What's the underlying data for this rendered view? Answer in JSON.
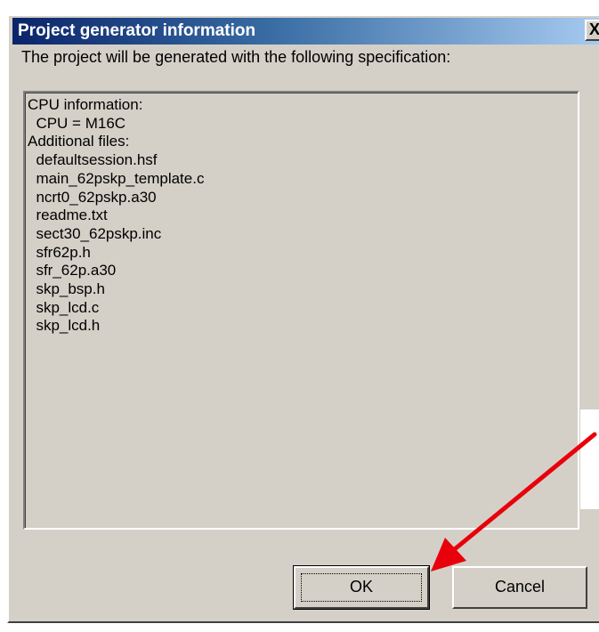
{
  "dialog": {
    "title": "Project generator information",
    "close_label": "X",
    "intro_text": "The project will be generated with the following specification:",
    "spec_lines": [
      "CPU information:",
      "  CPU = M16C",
      "Additional files:",
      "  defaultsession.hsf",
      "  main_62pskp_template.c",
      "  ncrt0_62pskp.a30",
      "  readme.txt",
      "  sect30_62pskp.inc",
      "  sfr62p.h",
      "  sfr_62p.a30",
      "  skp_bsp.h",
      "  skp_lcd.c",
      "  skp_lcd.h"
    ],
    "ok_label": "OK",
    "cancel_label": "Cancel"
  },
  "colors": {
    "title_bar_start": "#0a246a",
    "title_bar_end": "#a6caf0",
    "dialog_face": "#d4d0c8",
    "annotation_arrow": "#e8000b"
  },
  "icons": {
    "close": "close-icon",
    "annotation": "red-arrow-icon"
  }
}
